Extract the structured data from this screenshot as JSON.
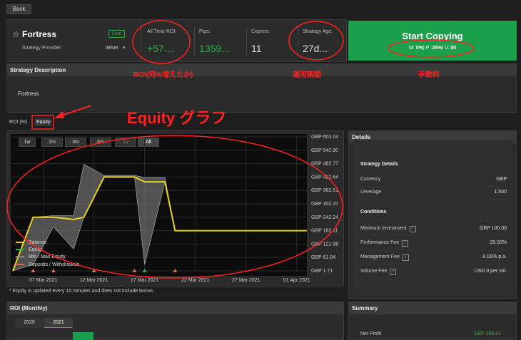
{
  "nav": {
    "back_label": "Back"
  },
  "header": {
    "star": "☆",
    "name": "Fortress",
    "live_badge": "Live",
    "provider_label": "Strategy Provider:",
    "provider_value": "Wiser",
    "roi_label": "All Time ROI:",
    "roi_value": "+57....",
    "pips_label": "Pips:",
    "pips_value": "1359...",
    "copiers_label": "Copiers:",
    "copiers_value": "11",
    "age_label": "Strategy Age:",
    "age_value": "27d...",
    "start_label": "Start Copying",
    "fees": {
      "m_label": "M:",
      "m_value": "0%",
      "p_label": "P:",
      "p_value": "25%",
      "v_label": "V:",
      "v_value": "$0"
    }
  },
  "annotations": {
    "roi": "ROI(何%増えたか)",
    "age": "運用期間",
    "fee": "手数料",
    "equity": "Equity グラフ"
  },
  "description": {
    "title": "Strategy Description",
    "text": "Fortress"
  },
  "tabs": {
    "roi": "ROI (%)",
    "equity": "Equity"
  },
  "ranges": [
    "1w",
    "1m",
    "3m",
    "6m",
    "1y",
    "All"
  ],
  "chart_data": {
    "type": "line",
    "x_ticks": [
      "07 Mar 2021",
      "12 Mar 2021",
      "17 Mar 2021",
      "22 Mar 2021",
      "27 Mar 2021",
      "01 Apr 2021"
    ],
    "y_ticks": [
      "GBP 603.04",
      "GBP 542.90",
      "GBP 482.77",
      "GBP 422.64",
      "GBP 362.51",
      "GBP 302.37",
      "GBP 242.24",
      "GBP 182.11",
      "GBP 121.98",
      "GBP 61.84",
      "GBP 1.71"
    ],
    "ylim": [
      1.71,
      603.04
    ],
    "legend": [
      "Balance",
      "Equity",
      "Min / Max Equity",
      "Deposits / Withdrawals"
    ],
    "series": [
      {
        "name": "Balance",
        "x": [
          "2021-03-04",
          "2021-03-06",
          "2021-03-08",
          "2021-03-10",
          "2021-03-11",
          "2021-03-13",
          "2021-03-16",
          "2021-03-17",
          "2021-03-19",
          "2021-03-20",
          "2021-04-02"
        ],
        "y": [
          1.71,
          242.24,
          242.24,
          232,
          242.24,
          422.64,
          422.64,
          401,
          401,
          182.11,
          182.11
        ]
      },
      {
        "name": "Min / Max Equity",
        "max": [
          1.71,
          242.24,
          250,
          250,
          480,
          430,
          430,
          420,
          420,
          182.11,
          182.11
        ],
        "min": [
          1.71,
          30,
          200,
          100,
          242.24,
          422.64,
          422.64,
          30,
          401,
          182.11,
          182.11
        ]
      }
    ],
    "deposit_markers": [
      "2021-03-06",
      "2021-03-08",
      "2021-03-12",
      "2021-03-16",
      "2021-03-17",
      "2021-03-20"
    ]
  },
  "footnote": "* Equity is updated every 15 minutes and does not include bonus.",
  "details": {
    "title": "Details",
    "strategy_details_title": "Strategy Details",
    "currency_label": "Currency",
    "currency_value": "GBP",
    "leverage_label": "Leverage",
    "leverage_value": "1:500",
    "conditions_title": "Conditions",
    "min_inv_label": "Minimum Investment",
    "min_inv_value": "GBP 100.00",
    "perf_fee_label": "Performance Fee",
    "perf_fee_value": "25.00%",
    "mgmt_fee_label": "Management Fee",
    "mgmt_fee_value": "0.00% p.a.",
    "vol_fee_label": "Volume Fee",
    "vol_fee_value": "USD 0 per mil."
  },
  "roi_monthly": {
    "title": "ROI (Monthly)",
    "years": [
      "2020",
      "2021"
    ]
  },
  "summary": {
    "title": "Summary",
    "net_profit_label": "Net Profit",
    "net_profit_value": "GBP 308.61"
  },
  "colors": {
    "accent_green": "#2fb24a",
    "annotation_red": "#ff2020",
    "balance_yellow": "#e8d21d"
  }
}
